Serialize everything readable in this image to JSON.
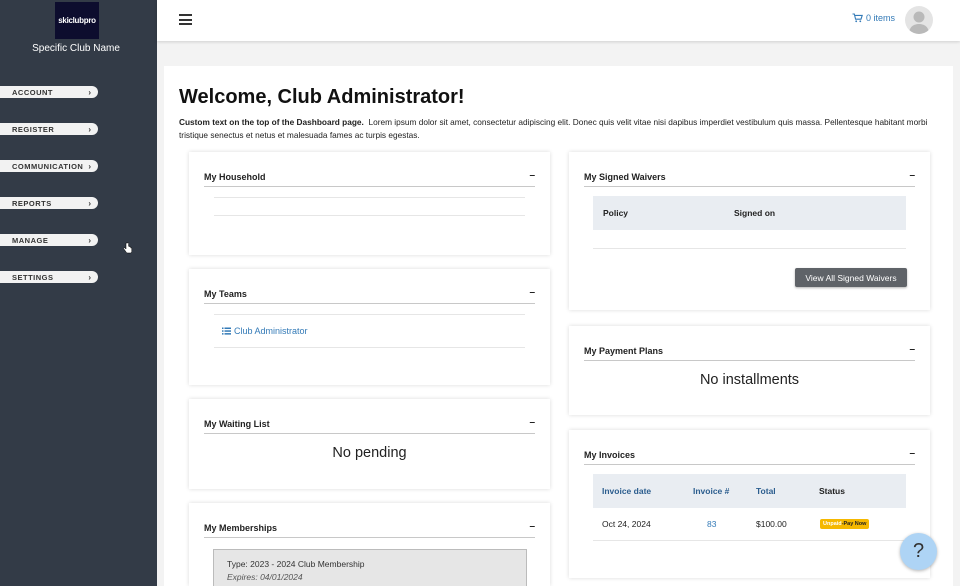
{
  "sidebar": {
    "logo_text": "skiclubpro",
    "club_name": "Specific Club Name",
    "items": [
      {
        "label": "ACCOUNT"
      },
      {
        "label": "REGISTER"
      },
      {
        "label": "COMMUNICATION"
      },
      {
        "label": "REPORTS"
      },
      {
        "label": "MANAGE"
      },
      {
        "label": "SETTINGS"
      }
    ]
  },
  "topbar": {
    "cart_label": "0 items"
  },
  "main": {
    "welcome": "Welcome, Club Administrator!",
    "intro_bold": "Custom text on the top of the Dashboard page.",
    "intro_text": "Lorem ipsum dolor sit amet, consectetur adipiscing elit. Donec quis velit vitae nisi dapibus imperdiet vestibulum quis massa. Pellentesque habitant morbi tristique senectus et netus et malesuada fames ac turpis egestas."
  },
  "panels": {
    "household": {
      "title": "My Household",
      "collapse": "–"
    },
    "teams": {
      "title": "My Teams",
      "collapse": "–",
      "link": "Club Administrator"
    },
    "waiting": {
      "title": "My Waiting List",
      "collapse": "–",
      "empty": "No pending"
    },
    "memberships": {
      "title": "My Memberships",
      "collapse": "–",
      "type": "Type: 2023 - 2024 Club Membership",
      "expires": "Expires: 04/01/2024"
    },
    "waivers": {
      "title": "My Signed Waivers",
      "collapse": "–",
      "col_policy": "Policy",
      "col_signed": "Signed on",
      "button": "View All Signed Waivers"
    },
    "payment_plans": {
      "title": "My Payment Plans",
      "collapse": "–",
      "empty": "No installments"
    },
    "invoices": {
      "title": "My Invoices",
      "collapse": "–",
      "columns": [
        "Invoice date",
        "Invoice #",
        "Total",
        "Status"
      ],
      "rows": [
        {
          "date": "Oct 24, 2024",
          "number": "83",
          "total": "$100.00",
          "status_unpaid": "Unpaid",
          "status_sep": " - ",
          "status_pay": "Pay Now"
        }
      ]
    }
  },
  "help": {
    "label": "?"
  },
  "colors": {
    "sidebar_bg": "#333b47",
    "link": "#337ab7",
    "badge": "#f5b800",
    "help_bg": "#aed4f5"
  }
}
